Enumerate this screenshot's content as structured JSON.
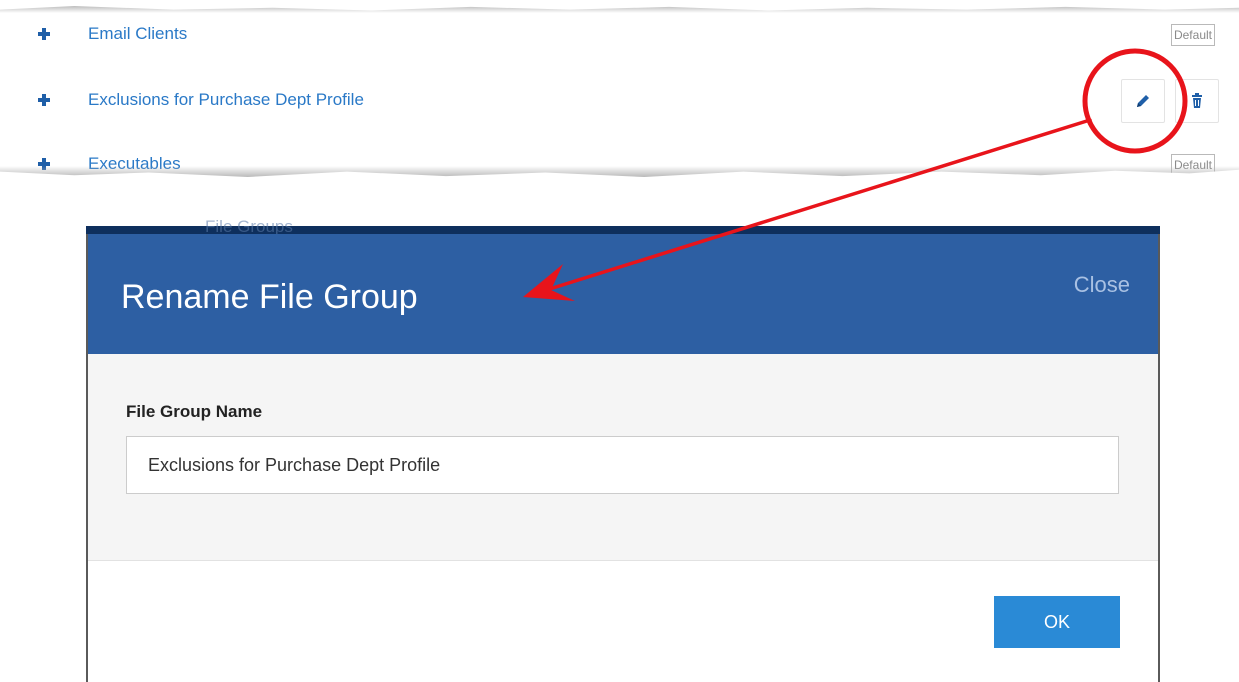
{
  "file_groups": {
    "rows": [
      {
        "name": "Email Clients",
        "badge": "Default"
      },
      {
        "name": "Exclusions for Purchase Dept Profile",
        "badge": ""
      },
      {
        "name": "Executables",
        "badge": "Default"
      }
    ]
  },
  "icons": {
    "expand": "plus-icon",
    "edit": "pencil-icon",
    "delete": "trash-icon"
  },
  "modal_background_title": "File Groups",
  "modal": {
    "title": "Rename File Group",
    "close_label": "Close",
    "field_label": "File Group Name",
    "field_value": "Exclusions for Purchase Dept Profile",
    "ok_label": "OK"
  },
  "annotation": {
    "circle_color": "#e8141b",
    "arrow_color": "#e8141b"
  },
  "colors": {
    "header_blue": "#2d5fa3",
    "link_blue": "#2a79c7",
    "ok_button": "#2a8ad6"
  }
}
